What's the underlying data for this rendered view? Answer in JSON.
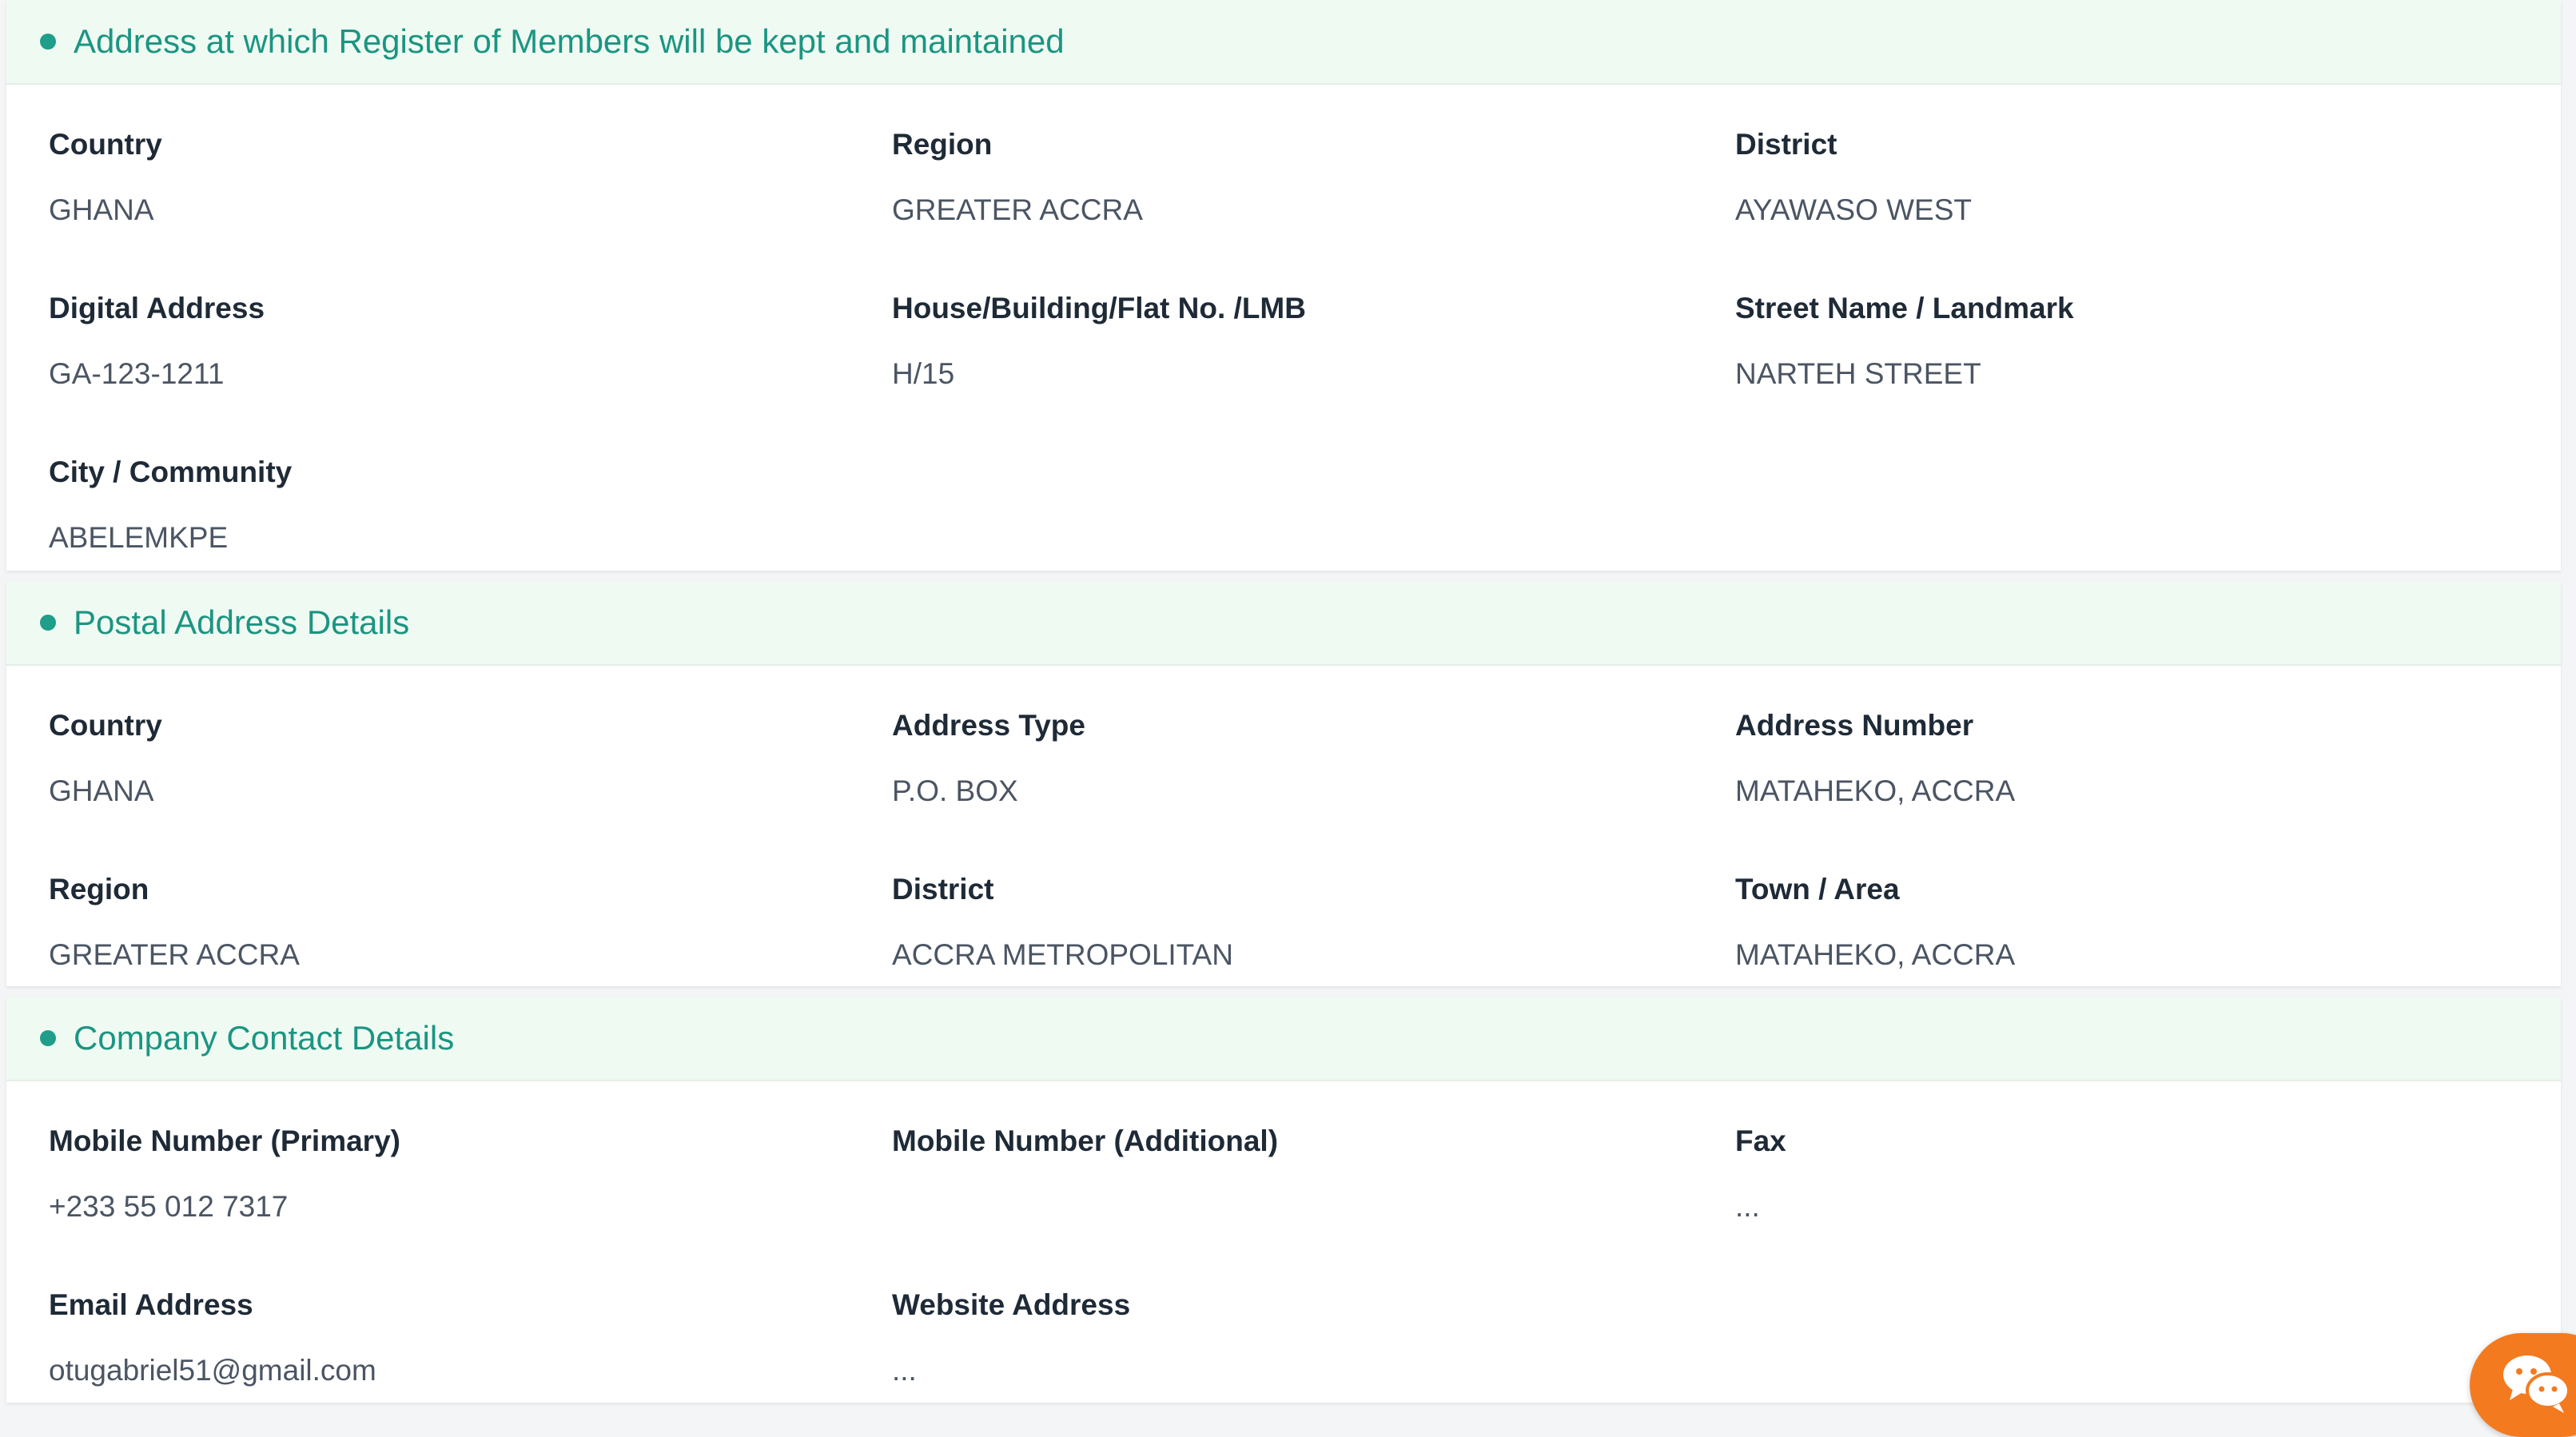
{
  "sections": [
    {
      "title": "Address at which Register of Members will be kept and maintained",
      "fields": [
        {
          "label": "Country",
          "value": "GHANA"
        },
        {
          "label": "Region",
          "value": "GREATER ACCRA"
        },
        {
          "label": "District",
          "value": "AYAWASO WEST"
        },
        {
          "label": "Digital Address",
          "value": "GA-123-1211"
        },
        {
          "label": "House/Building/Flat No. /LMB",
          "value": "H/15"
        },
        {
          "label": "Street Name / Landmark",
          "value": "NARTEH STREET"
        },
        {
          "label": "City / Community",
          "value": "ABELEMKPE"
        }
      ]
    },
    {
      "title": "Postal Address Details",
      "fields": [
        {
          "label": "Country",
          "value": "GHANA"
        },
        {
          "label": "Address Type",
          "value": "P.O. BOX"
        },
        {
          "label": "Address Number",
          "value": "MATAHEKO, ACCRA"
        },
        {
          "label": "Region",
          "value": "GREATER ACCRA"
        },
        {
          "label": "District",
          "value": "ACCRA METROPOLITAN"
        },
        {
          "label": "Town / Area",
          "value": "MATAHEKO, ACCRA"
        }
      ]
    },
    {
      "title": "Company Contact Details",
      "fields": [
        {
          "label": "Mobile Number (Primary)",
          "value": "+233 55 012 7317"
        },
        {
          "label": "Mobile Number (Additional)",
          "value": ""
        },
        {
          "label": "Fax",
          "value": "..."
        },
        {
          "label": "Email Address",
          "value": "otugabriel51@gmail.com"
        },
        {
          "label": "Website Address",
          "value": "..."
        }
      ]
    }
  ],
  "colors": {
    "accent": "#1b9582",
    "header_bg": "#effbf2",
    "chat_widget": "#f47a20"
  },
  "chat_widget_icon": "chat-bubbles-icon"
}
